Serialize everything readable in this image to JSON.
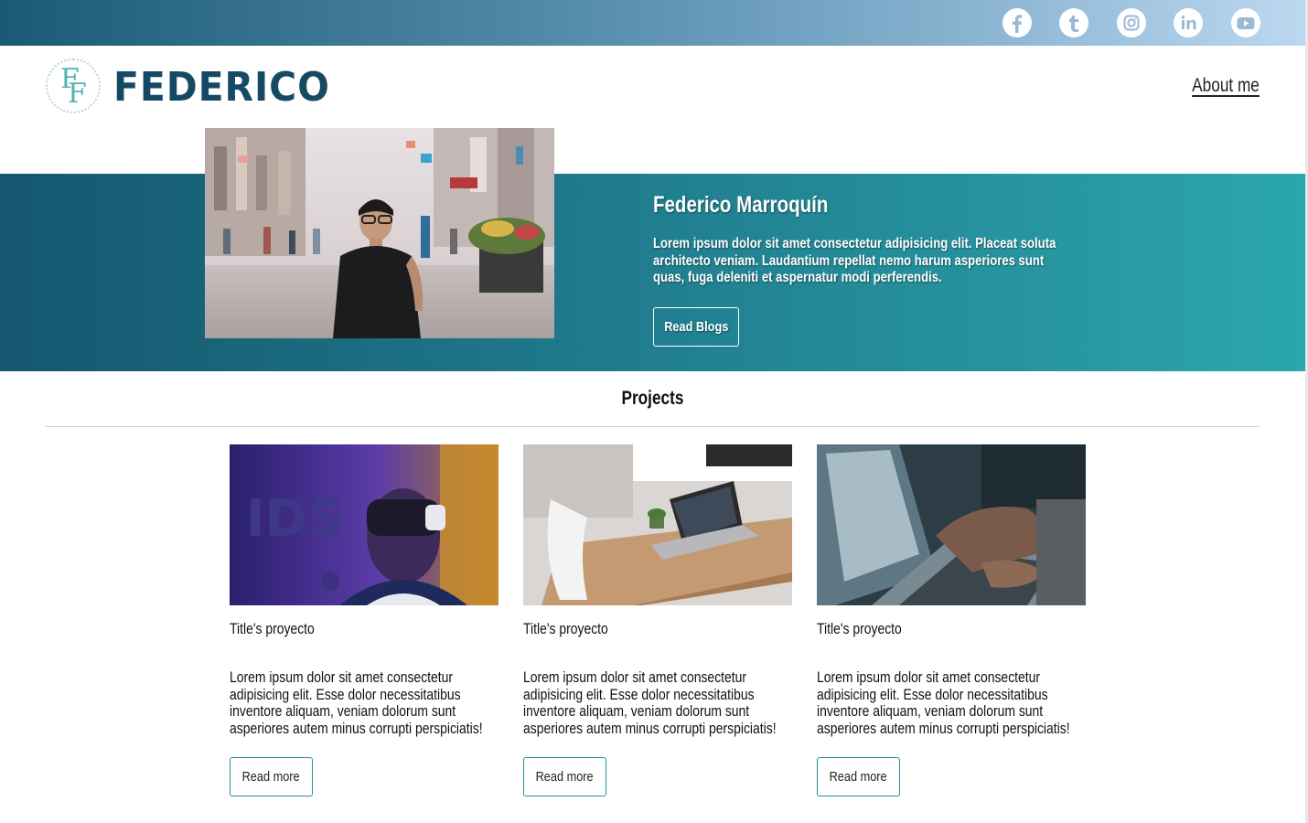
{
  "social": {
    "items": [
      {
        "name": "facebook-icon",
        "glyph": "f"
      },
      {
        "name": "tumblr-icon",
        "glyph": "t"
      },
      {
        "name": "instagram-icon",
        "glyph": "ig"
      },
      {
        "name": "linkedin-icon",
        "glyph": "in"
      },
      {
        "name": "youtube-icon",
        "glyph": "yt"
      }
    ],
    "icon_color": "#9ab9d6"
  },
  "header": {
    "logo_monogram_1": "F",
    "logo_monogram_2": "F",
    "logo_word": "FEDERICO",
    "about_label": "About me"
  },
  "hero": {
    "name": "Federico Marroquín",
    "text": "Lorem ipsum dolor sit amet consectetur adipisicing elit. Placeat soluta architecto veniam. Laudantium repellat nemo harum asperiores sunt quas, fuga deleniti et aspernatur modi perferendis.",
    "button_label": "Read Blogs"
  },
  "projects": {
    "title": "Projects",
    "cards": [
      {
        "title": "Title's proyecto",
        "text": "Lorem ipsum dolor sit amet consectetur adipisicing elit. Esse dolor necessitatibus inventore aliquam, veniam dolorum sunt asperiores autem minus corrupti perspiciatis!",
        "button_label": "Read more"
      },
      {
        "title": "Title's proyecto",
        "text": "Lorem ipsum dolor sit amet consectetur adipisicing elit. Esse dolor necessitatibus inventore aliquam, veniam dolorum sunt asperiores autem minus corrupti perspiciatis!",
        "button_label": "Read more"
      },
      {
        "title": "Title's proyecto",
        "text": "Lorem ipsum dolor sit amet consectetur adipisicing elit. Esse dolor necessitatibus inventore aliquam, veniam dolorum sunt asperiores autem minus corrupti perspiciatis!",
        "button_label": "Read more"
      }
    ]
  },
  "colors": {
    "brand": "#164a64",
    "accent": "#2ba6ad",
    "button_border": "#2a8f9a"
  }
}
